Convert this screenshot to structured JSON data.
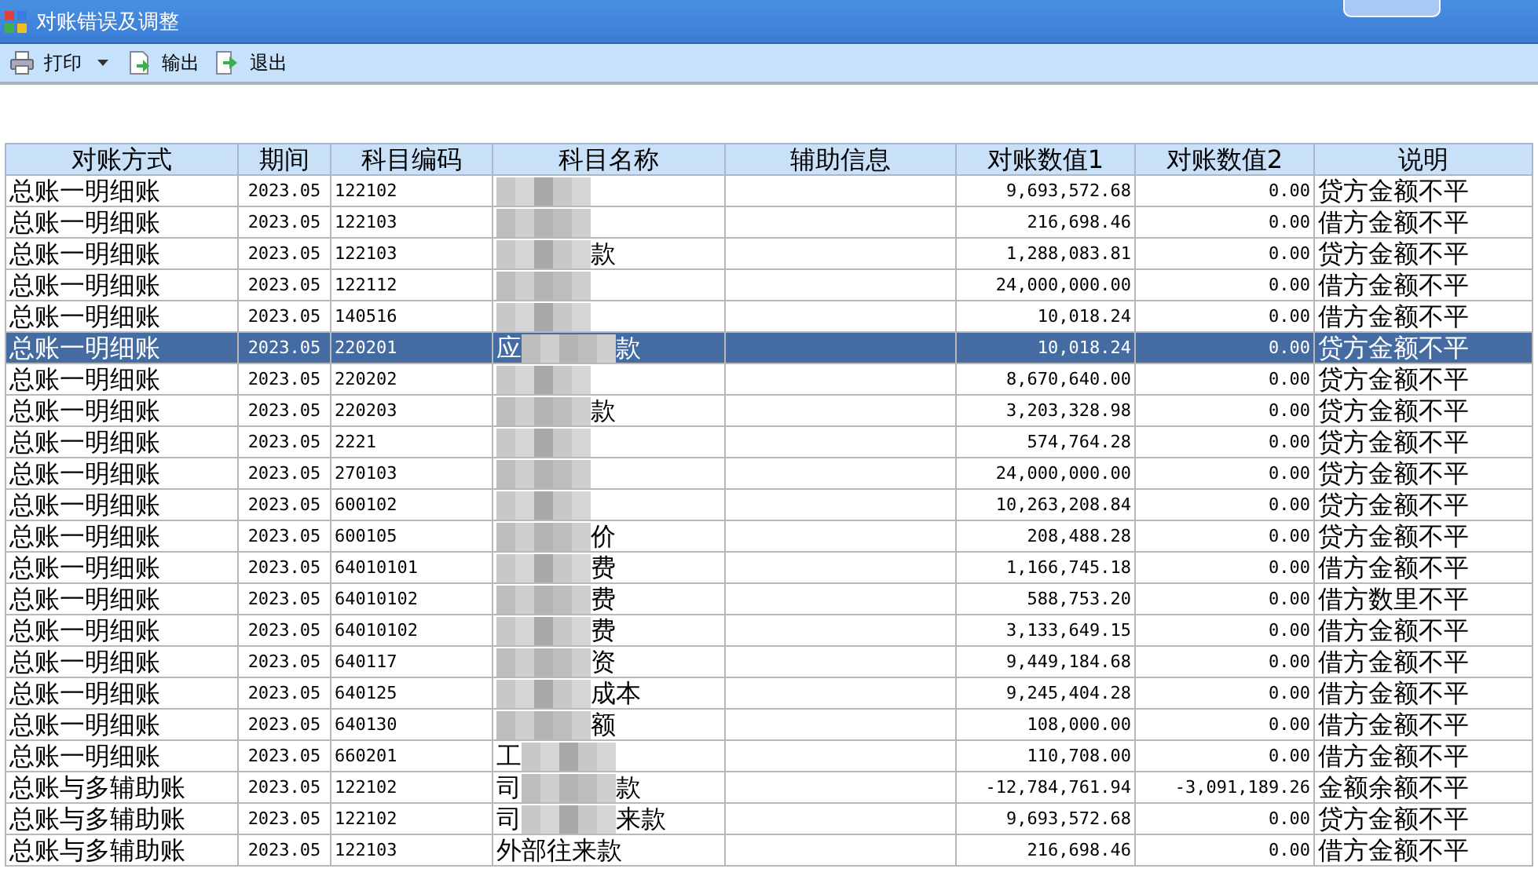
{
  "window": {
    "title": "对账错误及调整"
  },
  "toolbar": [
    {
      "label": "打印",
      "kind": "print",
      "dropdown": true
    },
    {
      "label": "输出",
      "kind": "export",
      "dropdown": false
    },
    {
      "label": "退出",
      "kind": "exit",
      "dropdown": false
    }
  ],
  "table": {
    "columns": [
      "对账方式",
      "期间",
      "科目编码",
      "科目名称",
      "辅助信息",
      "对账数值1",
      "对账数值2",
      "说明"
    ],
    "rows": [
      {
        "method": "总账一明细账",
        "period": "2023.05",
        "code": "122102",
        "redacted": true,
        "value1": "9,693,572.68",
        "value2": "0.00",
        "note": "贷方金额不平",
        "selected": false
      },
      {
        "method": "总账一明细账",
        "period": "2023.05",
        "code": "122103",
        "redacted": true,
        "value1": "216,698.46",
        "value2": "0.00",
        "note": "借方金额不平",
        "selected": false
      },
      {
        "method": "总账一明细账",
        "period": "2023.05",
        "code": "122103",
        "redacted": true,
        "name_end": "款",
        "value1": "1,288,083.81",
        "value2": "0.00",
        "note": "贷方金额不平",
        "selected": false
      },
      {
        "method": "总账一明细账",
        "period": "2023.05",
        "code": "122112",
        "redacted": true,
        "value1": "24,000,000.00",
        "value2": "0.00",
        "note": "借方金额不平",
        "selected": false
      },
      {
        "method": "总账一明细账",
        "period": "2023.05",
        "code": "140516",
        "redacted": true,
        "value1": "10,018.24",
        "value2": "0.00",
        "note": "借方金额不平",
        "selected": false
      },
      {
        "method": "总账一明细账",
        "period": "2023.05",
        "code": "220201",
        "redacted": true,
        "name_start": "应",
        "name_end": "款",
        "value1": "10,018.24",
        "value2": "0.00",
        "note": "贷方金额不平",
        "selected": true
      },
      {
        "method": "总账一明细账",
        "period": "2023.05",
        "code": "220202",
        "redacted": true,
        "value1": "8,670,640.00",
        "value2": "0.00",
        "note": "贷方金额不平",
        "selected": false
      },
      {
        "method": "总账一明细账",
        "period": "2023.05",
        "code": "220203",
        "redacted": true,
        "name_end": "款",
        "value1": "3,203,328.98",
        "value2": "0.00",
        "note": "贷方金额不平",
        "selected": false
      },
      {
        "method": "总账一明细账",
        "period": "2023.05",
        "code": "2221",
        "redacted": true,
        "value1": "574,764.28",
        "value2": "0.00",
        "note": "贷方金额不平",
        "selected": false
      },
      {
        "method": "总账一明细账",
        "period": "2023.05",
        "code": "270103",
        "redacted": true,
        "value1": "24,000,000.00",
        "value2": "0.00",
        "note": "贷方金额不平",
        "selected": false
      },
      {
        "method": "总账一明细账",
        "period": "2023.05",
        "code": "600102",
        "redacted": true,
        "value1": "10,263,208.84",
        "value2": "0.00",
        "note": "贷方金额不平",
        "selected": false
      },
      {
        "method": "总账一明细账",
        "period": "2023.05",
        "code": "600105",
        "redacted": true,
        "name_end": "价",
        "value1": "208,488.28",
        "value2": "0.00",
        "note": "贷方金额不平",
        "selected": false
      },
      {
        "method": "总账一明细账",
        "period": "2023.05",
        "code": "64010101",
        "redacted": true,
        "name_end": "费",
        "value1": "1,166,745.18",
        "value2": "0.00",
        "note": "借方金额不平",
        "selected": false
      },
      {
        "method": "总账一明细账",
        "period": "2023.05",
        "code": "64010102",
        "redacted": true,
        "name_end": "费",
        "value1": "588,753.20",
        "value2": "0.00",
        "note": "借方数里不平",
        "selected": false
      },
      {
        "method": "总账一明细账",
        "period": "2023.05",
        "code": "64010102",
        "redacted": true,
        "name_end": "费",
        "value1": "3,133,649.15",
        "value2": "0.00",
        "note": "借方金额不平",
        "selected": false
      },
      {
        "method": "总账一明细账",
        "period": "2023.05",
        "code": "640117",
        "redacted": true,
        "name_end": "资",
        "value1": "9,449,184.68",
        "value2": "0.00",
        "note": "借方金额不平",
        "selected": false
      },
      {
        "method": "总账一明细账",
        "period": "2023.05",
        "code": "640125",
        "redacted": true,
        "name_end": "成本",
        "value1": "9,245,404.28",
        "value2": "0.00",
        "note": "借方金额不平",
        "selected": false
      },
      {
        "method": "总账一明细账",
        "period": "2023.05",
        "code": "640130",
        "redacted": true,
        "name_end": "额",
        "value1": "108,000.00",
        "value2": "0.00",
        "note": "借方金额不平",
        "selected": false
      },
      {
        "method": "总账一明细账",
        "period": "2023.05",
        "code": "660201",
        "redacted": true,
        "name_start": "工",
        "value1": "110,708.00",
        "value2": "0.00",
        "note": "借方金额不平",
        "selected": false
      },
      {
        "method": "总账与多辅助账",
        "period": "2023.05",
        "code": "122102",
        "redacted": true,
        "name_start": "司",
        "name_end": "款",
        "value1": "-12,784,761.94",
        "value2": "-3,091,189.26",
        "note": "金额余额不平",
        "selected": false
      },
      {
        "method": "总账与多辅助账",
        "period": "2023.05",
        "code": "122102",
        "redacted": true,
        "name_start": "司",
        "name_end": "来款",
        "value1": "9,693,572.68",
        "value2": "0.00",
        "note": "贷方金额不平",
        "selected": false
      },
      {
        "method": "总账与多辅助账",
        "period": "2023.05",
        "code": "122103",
        "redacted": false,
        "name_start": "外部往来款",
        "value1": "216,698.46",
        "value2": "0.00",
        "note": "借方金额不平",
        "selected": false
      }
    ]
  }
}
